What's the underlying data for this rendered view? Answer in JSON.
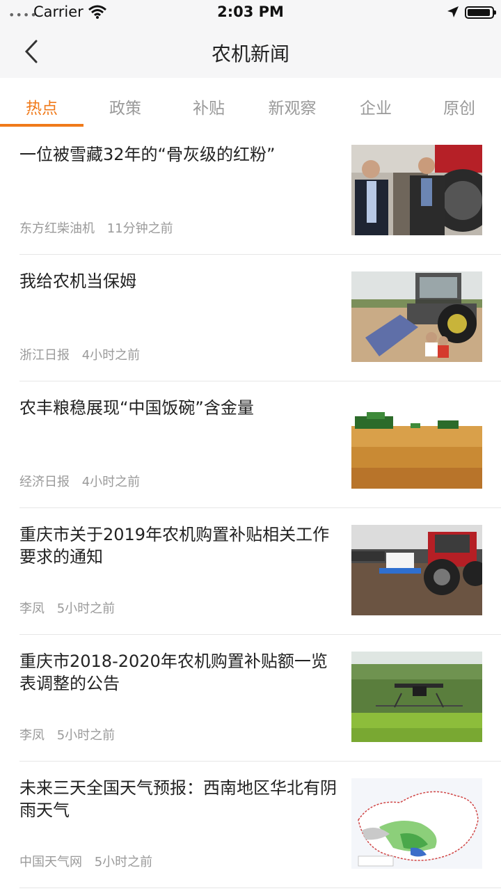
{
  "status": {
    "carrier": "Carrier",
    "time": "2:03 PM"
  },
  "nav": {
    "title": "农机新闻"
  },
  "tabs": [
    "热点",
    "政策",
    "补贴",
    "新观察",
    "企业",
    "原创"
  ],
  "active_tab": 0,
  "articles": [
    {
      "title": "一位被雪藏32年的“骨灰级的红粉”",
      "source": "东方红柴油机",
      "time": "11分钟之前",
      "image": "photo-two-men-tractor"
    },
    {
      "title": "我给农机当保姆",
      "source": "浙江日报",
      "time": "4小时之前",
      "image": "photo-tractor-field-workers"
    },
    {
      "title": "农丰粮稳展现“中国饭碗”含金量",
      "source": "经济日报",
      "time": "4小时之前",
      "image": "photo-wheat-harvest"
    },
    {
      "title": "重庆市关于2019年农机购置补贴相关工作要求的通知",
      "source": "李凤",
      "time": "5小时之前",
      "image": "photo-red-tractor-crowd"
    },
    {
      "title": "重庆市2018-2020年农机购置补贴额一览表调整的公告",
      "source": "李凤",
      "time": "5小时之前",
      "image": "photo-crop-drone"
    },
    {
      "title": "未来三天全国天气预报：西南地区华北有阴雨天气",
      "source": "中国天气网",
      "time": "5小时之前",
      "image": "weather-map-china"
    }
  ]
}
